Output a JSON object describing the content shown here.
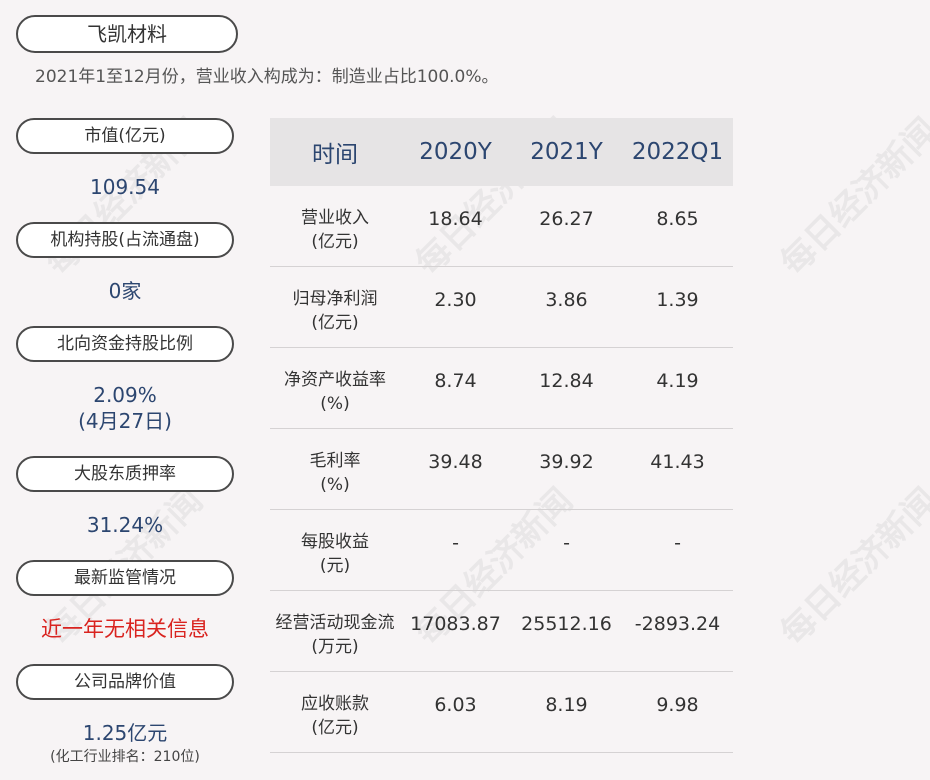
{
  "header": {
    "company": "飞凯材料",
    "subtitle": "2021年1至12月份，营业收入构成为：制造业占比100.0%。"
  },
  "left": {
    "market_cap": {
      "label": "市值(亿元)",
      "value": "109.54"
    },
    "institutional": {
      "label": "机构持股(占流通盘)",
      "value": "0家"
    },
    "northbound": {
      "label": "北向资金持股比例",
      "value": "2.09%",
      "value2": "(4月27日)"
    },
    "pledge": {
      "label": "大股东质押率",
      "value": "31.24%"
    },
    "regulation": {
      "label": "最新监管情况",
      "value": "近一年无相关信息"
    },
    "brand": {
      "label": "公司品牌价值",
      "value": "1.25亿元",
      "note": "(化工行业排名：210位)"
    }
  },
  "table": {
    "headers": [
      "时间",
      "2020Y",
      "2021Y",
      "2022Q1"
    ],
    "rows": [
      {
        "label1": "营业收入",
        "label2": "(亿元)",
        "values": [
          "18.64",
          "26.27",
          "8.65"
        ]
      },
      {
        "label1": "归母净利润",
        "label2": "(亿元)",
        "values": [
          "2.30",
          "3.86",
          "1.39"
        ]
      },
      {
        "label1": "净资产收益率",
        "label2": "(%)",
        "values": [
          "8.74",
          "12.84",
          "4.19"
        ]
      },
      {
        "label1": "毛利率",
        "label2": "(%)",
        "values": [
          "39.48",
          "39.92",
          "41.43"
        ]
      },
      {
        "label1": "每股收益",
        "label2": "(元)",
        "values": [
          "-",
          "-",
          "-"
        ]
      },
      {
        "label1": "经营活动现金流",
        "label2": "(万元)",
        "values": [
          "17083.87",
          "25512.16",
          "-2893.24"
        ]
      },
      {
        "label1": "应收账款",
        "label2": "(亿元)",
        "values": [
          "6.03",
          "8.19",
          "9.98"
        ]
      }
    ]
  },
  "watermark": "每日经济新闻",
  "colors": {
    "accent_blue": "#2c4670",
    "alert_red": "#d9231f",
    "header_bg": "#e6e4e5"
  }
}
